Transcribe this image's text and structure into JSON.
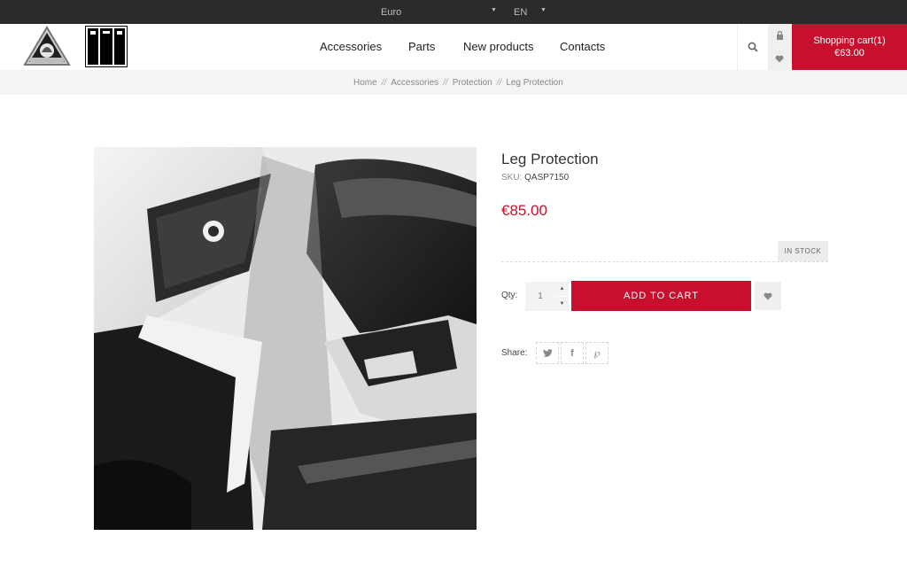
{
  "topbar": {
    "currency": "Euro",
    "language": "EN"
  },
  "nav": {
    "items": [
      "Accessories",
      "Parts",
      "New products",
      "Contacts"
    ]
  },
  "cart": {
    "label": "Shopping cart",
    "count": "(1)",
    "amount": "€63.00"
  },
  "breadcrumb": [
    "Home",
    "Accessories",
    "Protection",
    "Leg Protection"
  ],
  "product": {
    "title": "Leg Protection",
    "sku_label": "SKU:",
    "sku": "QASP7150",
    "price": "€85.00",
    "stock": "IN STOCK",
    "qty_label": "Qty:",
    "qty_placeholder": "1",
    "add_to_cart": "ADD TO CART",
    "share_label": "Share:"
  },
  "colors": {
    "accent": "#c8102e",
    "topbar": "#2b2b2b"
  },
  "icons": [
    "search-icon",
    "lock-icon",
    "heart-icon",
    "twitter-icon",
    "facebook-icon",
    "pinterest-icon"
  ]
}
